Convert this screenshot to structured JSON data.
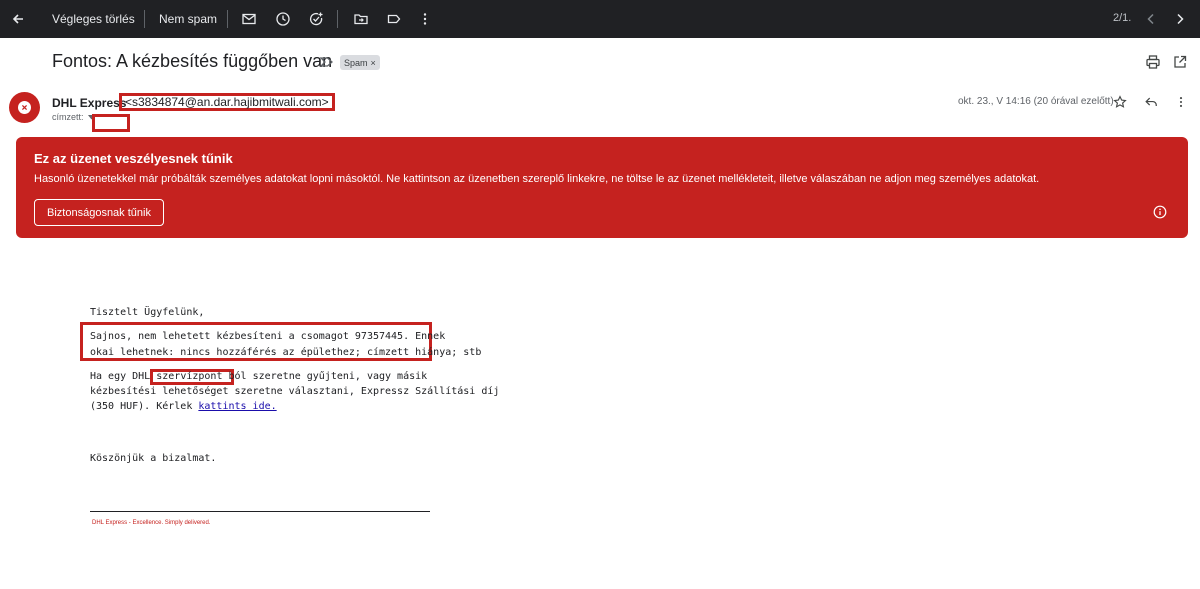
{
  "toolbar": {
    "back_icon": "arrow-left-icon",
    "delete_forever_label": "Végleges törlés",
    "not_spam_label": "Nem spam",
    "icons": [
      "mail-icon",
      "clock-icon",
      "add-task-icon",
      "move-to-folder-icon",
      "label-icon",
      "more-vert-icon"
    ],
    "counter": "2/1.",
    "prev_icon": "chevron-left-icon",
    "next_icon": "chevron-right-icon",
    "bg_color": "#202124"
  },
  "subject": {
    "title": "Fontos: A kézbesítés függőben van",
    "importance_icon": "importance-marker-icon",
    "chip_label": "Spam",
    "chip_close": "×",
    "print_icon": "print-icon",
    "open_new_icon": "open-in-new-icon"
  },
  "sender": {
    "name": "DHL Express",
    "email": "<s3834874@an.dar.hajibmitwali.com>",
    "to_label": "címzett:",
    "date": "okt. 23., V 14:16 (20 órával ezelőtt)",
    "star_icon": "star-icon",
    "reply_icon": "reply-icon",
    "more_icon": "more-vert-icon",
    "avatar_color": "#c5221f",
    "avatar_icon": "close-circle-icon"
  },
  "warning": {
    "title": "Ez az üzenet veszélyesnek tűnik",
    "text": "Hasonló üzenetekkel már próbálták személyes adatokat lopni másoktól. Ne kattintson az üzenetben szereplő linkekre, ne töltse le az üzenet mellékleteit, illetve válaszában ne adjon meg személyes adatokat.",
    "button_label": "Biztonságosnak tűnik",
    "info_icon": "info-icon",
    "color": "#c5221f"
  },
  "body": {
    "greeting": "Tisztelt Ügyfelünk,",
    "p1_line1": "Sajnos, nem lehetett kézbesíteni a csomagot 97357445. Ennek",
    "p1_line2": "okai lehetnek: nincs hozzáférés az épülethez; címzett hiánya; stb",
    "p2_line1_a": "Ha egy DHL ",
    "p2_line1_b": "szervízpont ból",
    "p2_line1_c": " szeretne gyűjteni, vagy másik",
    "p2_line2": "kézbesítési lehetőséget szeretne választani, Expressz Szállítási díj",
    "p2_line3_a": "(350 HUF). Kérlek ",
    "p2_link": "kattints ide.",
    "thanks": "Köszönjük a bizalmat.",
    "signature": "DHL Express - Excellence. Simply delivered."
  }
}
